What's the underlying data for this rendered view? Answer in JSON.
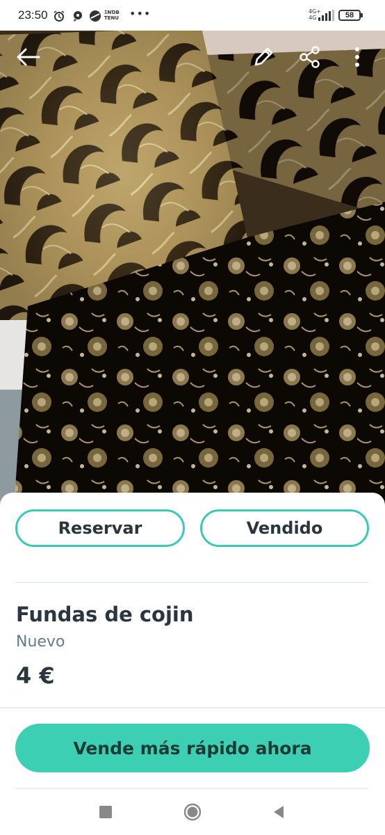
{
  "status_bar": {
    "time": "23:50",
    "mini_text_top": "ΞΝΌΒ",
    "mini_text_bottom": "ΤΕΝU",
    "more": "•••",
    "network_top": "4G+",
    "network_bottom": "4G",
    "battery": "58"
  },
  "toolbar": {
    "back_icon": "arrow-left-icon",
    "edit_icon": "pencil-icon",
    "share_icon": "share-icon",
    "more_icon": "more-vertical-icon"
  },
  "actions": {
    "reserve_label": "Reservar",
    "sold_label": "Vendido"
  },
  "product": {
    "title": "Fundas de cojin",
    "condition": "Nuevo",
    "price": "4 €"
  },
  "promo": {
    "cta_label": "Vende más rápido ahora"
  },
  "colors": {
    "accent": "#3ccfb4",
    "accent_border": "#3bc9b3",
    "text": "#29363d",
    "muted": "#607d8b"
  },
  "nav_bar": {
    "recents_icon": "square-icon",
    "home_icon": "circle-home-icon",
    "back_icon": "triangle-back-icon"
  }
}
